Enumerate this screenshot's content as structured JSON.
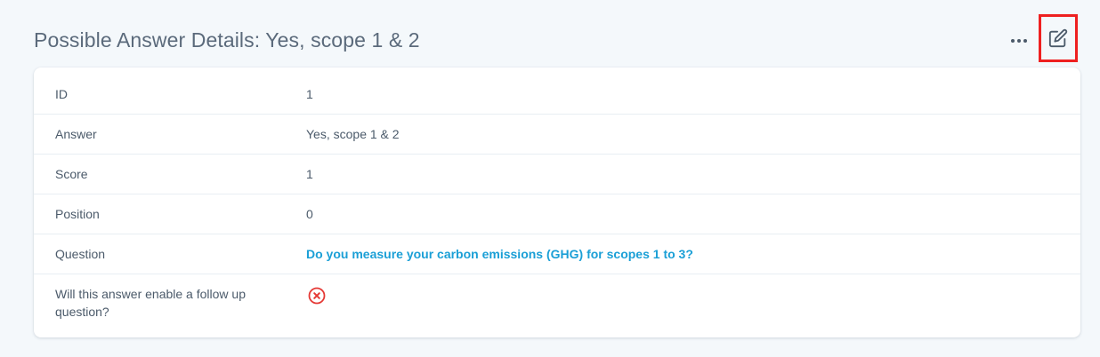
{
  "header": {
    "title": "Possible Answer Details: Yes, scope 1 & 2",
    "more_icon": "more-horizontal-icon",
    "edit_icon": "edit-icon",
    "highlight_color": "#ee2020"
  },
  "details": {
    "rows": [
      {
        "label": "ID",
        "value": "1"
      },
      {
        "label": "Answer",
        "value": "Yes, scope 1 & 2"
      },
      {
        "label": "Score",
        "value": "1"
      },
      {
        "label": "Position",
        "value": "0"
      },
      {
        "label": "Question",
        "value": "Do you measure your carbon emissions (GHG) for scopes 1 to 3?"
      },
      {
        "label": "Will this answer enable a follow up question?",
        "value_icon": "x-circle-icon",
        "value_state": "false"
      }
    ]
  },
  "colors": {
    "link": "#1a9fd6",
    "negative": "#e53935",
    "text": "#4b5a6a",
    "title": "#5b6a7b",
    "background": "#f4f8fb"
  }
}
